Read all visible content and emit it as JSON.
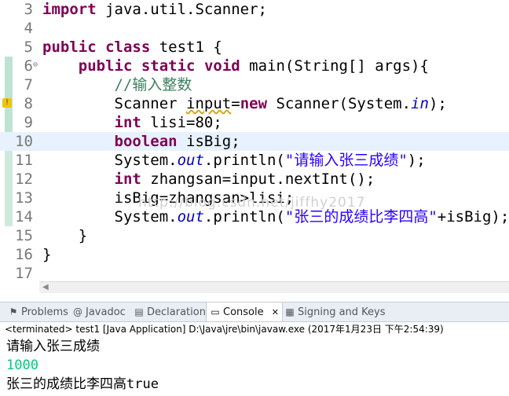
{
  "editor": {
    "lines": [
      {
        "num": "3",
        "segments": [
          {
            "t": "import",
            "c": "kw"
          },
          {
            "t": " java.util.Scanner;",
            "c": ""
          }
        ]
      },
      {
        "num": "4",
        "segments": []
      },
      {
        "num": "5",
        "segments": [
          {
            "t": "public",
            "c": "kw"
          },
          {
            "t": " ",
            "c": ""
          },
          {
            "t": "class",
            "c": "kw"
          },
          {
            "t": " test1 {",
            "c": ""
          }
        ]
      },
      {
        "num": "6",
        "fold": true,
        "segments": [
          {
            "t": "    ",
            "c": ""
          },
          {
            "t": "public",
            "c": "kw"
          },
          {
            "t": " ",
            "c": ""
          },
          {
            "t": "static",
            "c": "kw"
          },
          {
            "t": " ",
            "c": ""
          },
          {
            "t": "void",
            "c": "kw"
          },
          {
            "t": " main(String[] args){",
            "c": ""
          }
        ]
      },
      {
        "num": "7",
        "segments": [
          {
            "t": "        ",
            "c": ""
          },
          {
            "t": "//输入整数",
            "c": "cm"
          }
        ]
      },
      {
        "num": "8",
        "warning": true,
        "segments": [
          {
            "t": "        Scanner ",
            "c": ""
          },
          {
            "t": "input",
            "c": "warn"
          },
          {
            "t": "=",
            "c": ""
          },
          {
            "t": "new",
            "c": "kw"
          },
          {
            "t": " Scanner(System.",
            "c": ""
          },
          {
            "t": "in",
            "c": "fld"
          },
          {
            "t": ");",
            "c": ""
          }
        ]
      },
      {
        "num": "9",
        "segments": [
          {
            "t": "        ",
            "c": ""
          },
          {
            "t": "int",
            "c": "kw"
          },
          {
            "t": " lisi=80;",
            "c": ""
          }
        ]
      },
      {
        "num": "10",
        "current": true,
        "segments": [
          {
            "t": "        ",
            "c": ""
          },
          {
            "t": "boolean",
            "c": "kw"
          },
          {
            "t": " isBig;",
            "c": ""
          }
        ]
      },
      {
        "num": "11",
        "segments": [
          {
            "t": "        System.",
            "c": ""
          },
          {
            "t": "out",
            "c": "fld"
          },
          {
            "t": ".println(",
            "c": ""
          },
          {
            "t": "\"请输入张三成绩\"",
            "c": "str"
          },
          {
            "t": ");",
            "c": ""
          }
        ]
      },
      {
        "num": "12",
        "segments": [
          {
            "t": "        ",
            "c": ""
          },
          {
            "t": "int",
            "c": "kw"
          },
          {
            "t": " zhangsan=input.nextInt();",
            "c": ""
          }
        ]
      },
      {
        "num": "13",
        "segments": [
          {
            "t": "        isBig=zhangsan>lisi;",
            "c": ""
          }
        ]
      },
      {
        "num": "14",
        "segments": [
          {
            "t": "        System.",
            "c": ""
          },
          {
            "t": "out",
            "c": "fld"
          },
          {
            "t": ".println(",
            "c": ""
          },
          {
            "t": "\"张三的成绩比李四高\"",
            "c": "str"
          },
          {
            "t": "+isBig);",
            "c": ""
          }
        ]
      },
      {
        "num": "15",
        "segments": [
          {
            "t": "    }",
            "c": ""
          }
        ]
      },
      {
        "num": "16",
        "segments": [
          {
            "t": "}",
            "c": ""
          }
        ]
      },
      {
        "num": "17",
        "segments": []
      }
    ],
    "watermark": "http://blog.csdn.net/jiffhy2017"
  },
  "tabs": [
    {
      "label": "Problems",
      "icon": "problems-icon",
      "glyph": "⚑"
    },
    {
      "label": "Javadoc",
      "icon": "javadoc-icon",
      "glyph": "@"
    },
    {
      "label": "Declaration",
      "icon": "declaration-icon",
      "glyph": "▤"
    },
    {
      "label": "Console",
      "icon": "console-icon",
      "glyph": "▭",
      "active": true,
      "close": "✕"
    },
    {
      "label": "Signing and Keys",
      "icon": "signing-keys-icon",
      "glyph": "▦"
    }
  ],
  "console": {
    "status": "<terminated> test1 [Java Application] D:\\Java\\jre\\bin\\javaw.exe (2017年1月23日 下午2:54:39)",
    "prompt_line": "请输入张三成绩",
    "user_input": "1000",
    "result_prefix": "张三的成绩比李四高",
    "result_value": "true"
  },
  "colors": {
    "keyword": "#7f0055",
    "string": "#2a00ff",
    "comment": "#3f7f5f",
    "field": "#0000c0",
    "console_input": "#00c87a"
  }
}
